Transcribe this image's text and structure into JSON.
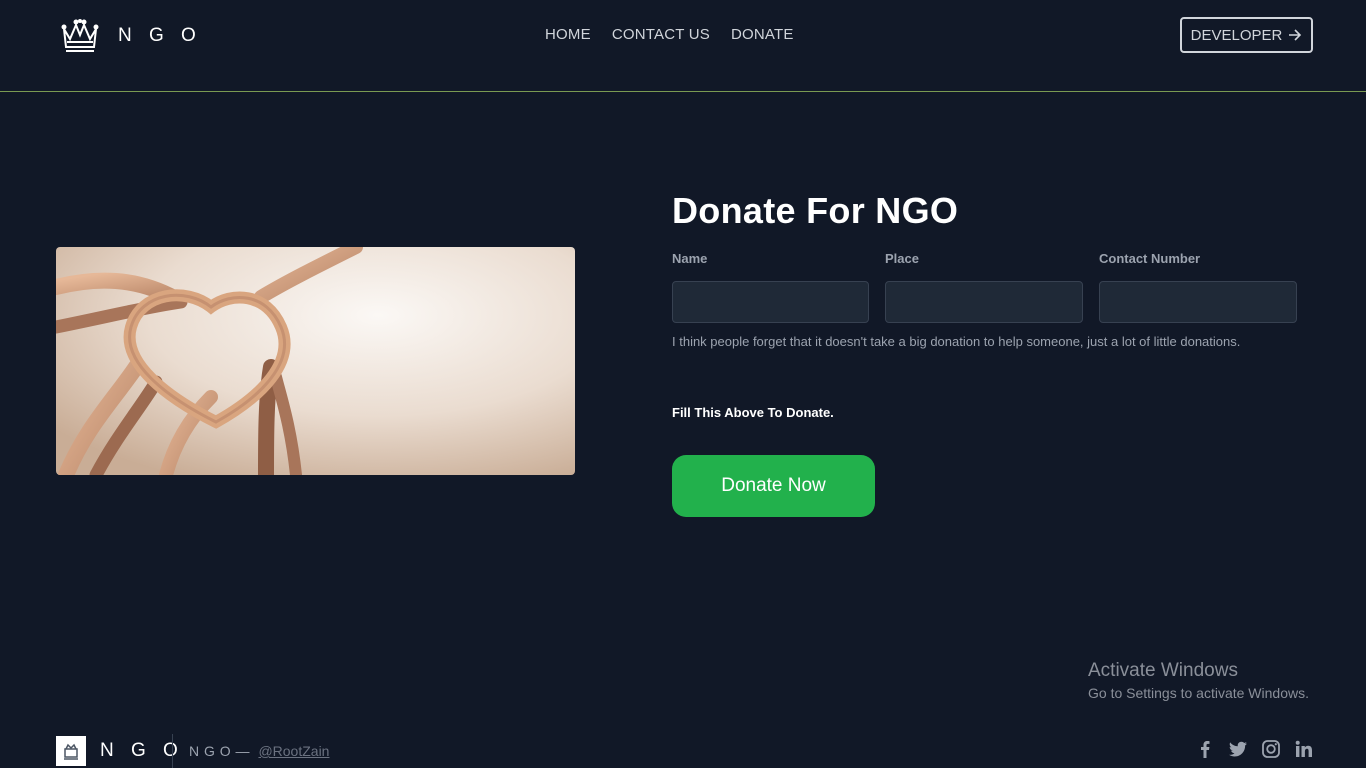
{
  "brand": {
    "name": "N G O"
  },
  "nav": {
    "items": [
      "HOME",
      "CONTACT US",
      "DONATE"
    ]
  },
  "header": {
    "developer_label": "DEVELOPER"
  },
  "form": {
    "title": "Donate For NGO",
    "fields": [
      {
        "label": "Name",
        "value": ""
      },
      {
        "label": "Place",
        "value": ""
      },
      {
        "label": "Contact Number",
        "value": ""
      }
    ],
    "quote": "I think people forget that it doesn't take a big donation to help someone, just a lot of little donations.",
    "note": "Fill This Above To Donate.",
    "submit_label": "Donate Now"
  },
  "watermark": {
    "title": "Activate Windows",
    "subtitle": "Go to Settings to activate Windows."
  },
  "footer": {
    "brand": "N G O",
    "copy": "N G O —",
    "handle": "@RootZain",
    "socials": [
      "facebook-icon",
      "twitter-icon",
      "instagram-icon",
      "linkedin-icon"
    ]
  },
  "colors": {
    "background": "#111827",
    "accent_green": "#22b14c",
    "header_rule": "#7a9a52"
  }
}
